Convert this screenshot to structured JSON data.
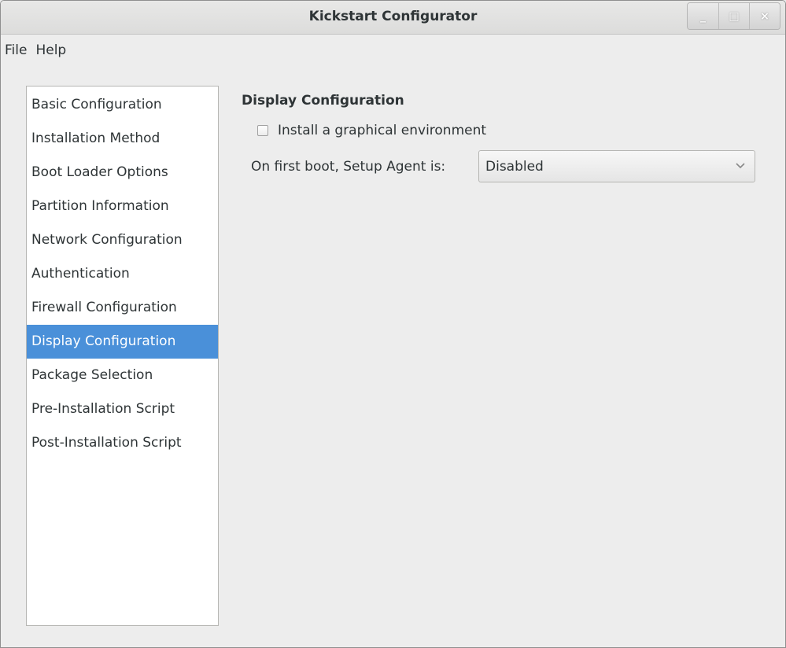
{
  "window": {
    "title": "Kickstart Configurator",
    "controls": {
      "minimize": "_",
      "maximize": "□",
      "close": "×"
    }
  },
  "menu": [
    "File",
    "Help"
  ],
  "sidebar": {
    "items": [
      {
        "label": "Basic Configuration"
      },
      {
        "label": "Installation Method"
      },
      {
        "label": "Boot Loader Options"
      },
      {
        "label": "Partition Information"
      },
      {
        "label": "Network Configuration"
      },
      {
        "label": "Authentication"
      },
      {
        "label": "Firewall Configuration"
      },
      {
        "label": "Display Configuration"
      },
      {
        "label": "Package Selection"
      },
      {
        "label": "Pre-Installation Script"
      },
      {
        "label": "Post-Installation Script"
      }
    ],
    "selected_index": 7
  },
  "display": {
    "title": "Display Configuration",
    "graphical_env_label": "Install a graphical environment",
    "graphical_env_checked": false,
    "setup_agent_label": "On first boot, Setup Agent is:",
    "setup_agent_value": "Disabled"
  },
  "colors": {
    "accent": "#4a90d9",
    "window_bg": "#ededed"
  }
}
